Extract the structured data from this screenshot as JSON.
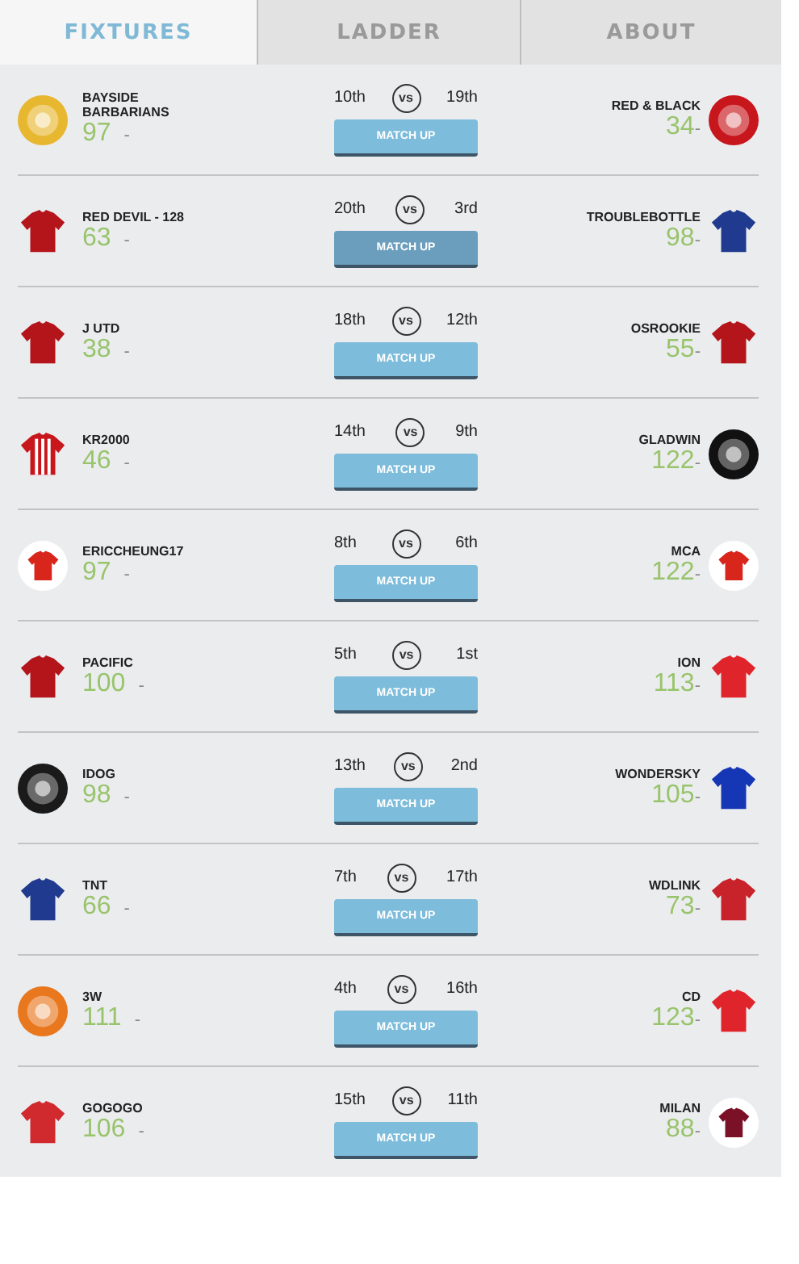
{
  "tabs": [
    {
      "label": "FIXTURES",
      "selected": true
    },
    {
      "label": "LADDER",
      "selected": false
    },
    {
      "label": "ABOUT",
      "selected": false
    }
  ],
  "fixtures": [
    {
      "home": {
        "name": "BAYSIDE BARBARIANS",
        "score": "97",
        "mark": "-",
        "kind": "badge",
        "color": "#e8b730"
      },
      "home_rank": "10th",
      "vs": "vs",
      "away_rank": "19th",
      "button": {
        "label": "MATCH UP",
        "active": false
      },
      "away": {
        "name": "RED & BLACK",
        "score": "34",
        "mark": "-",
        "kind": "badge",
        "color": "#c8161d"
      }
    },
    {
      "home": {
        "name": "RED DEVIL - 128",
        "score": "63",
        "mark": "-",
        "kind": "shirt",
        "color": "#b3151b"
      },
      "home_rank": "20th",
      "vs": "vs",
      "away_rank": "3rd",
      "button": {
        "label": "MATCH UP",
        "active": true
      },
      "away": {
        "name": "TROUBLEBOTTLE",
        "score": "98",
        "mark": "-",
        "kind": "shirt",
        "color": "#1f3a8f"
      }
    },
    {
      "home": {
        "name": "J UTD",
        "score": "38",
        "mark": "-",
        "kind": "shirt",
        "color": "#b3151b"
      },
      "home_rank": "18th",
      "vs": "vs",
      "away_rank": "12th",
      "button": {
        "label": "MATCH UP",
        "active": false
      },
      "away": {
        "name": "OSROOKIE",
        "score": "55",
        "mark": "-",
        "kind": "shirt",
        "color": "#b3151b"
      }
    },
    {
      "home": {
        "name": "KR2000",
        "score": "46",
        "mark": "-",
        "kind": "striped-shirt",
        "color": "#c8161d"
      },
      "home_rank": "14th",
      "vs": "vs",
      "away_rank": "9th",
      "button": {
        "label": "MATCH UP",
        "active": false
      },
      "away": {
        "name": "GLADWIN",
        "score": "122",
        "mark": "-",
        "kind": "badge",
        "color": "#111111"
      }
    },
    {
      "home": {
        "name": "ERICCHEUNG17",
        "score": "97",
        "mark": "-",
        "kind": "shirt-disc",
        "color": "#d9261c"
      },
      "home_rank": "8th",
      "vs": "vs",
      "away_rank": "6th",
      "button": {
        "label": "MATCH UP",
        "active": false
      },
      "away": {
        "name": "MCA",
        "score": "122",
        "mark": "-",
        "kind": "shirt-disc",
        "color": "#d9261c"
      }
    },
    {
      "home": {
        "name": "PACIFIC",
        "score": "100",
        "mark": "-",
        "kind": "shirt",
        "color": "#b3151b"
      },
      "home_rank": "5th",
      "vs": "vs",
      "away_rank": "1st",
      "button": {
        "label": "MATCH UP",
        "active": false
      },
      "away": {
        "name": "ION",
        "score": "113",
        "mark": "-",
        "kind": "shirt",
        "color": "#e0242b"
      }
    },
    {
      "home": {
        "name": "IDOG",
        "score": "98",
        "mark": "-",
        "kind": "badge",
        "color": "#1a1a1a"
      },
      "home_rank": "13th",
      "vs": "vs",
      "away_rank": "2nd",
      "button": {
        "label": "MATCH UP",
        "active": false
      },
      "away": {
        "name": "WONDERSKY",
        "score": "105",
        "mark": "-",
        "kind": "shirt",
        "color": "#1537b5"
      }
    },
    {
      "home": {
        "name": "TNT",
        "score": "66",
        "mark": "-",
        "kind": "shirt",
        "color": "#1f3a8f"
      },
      "home_rank": "7th",
      "vs": "vs",
      "away_rank": "17th",
      "button": {
        "label": "MATCH UP",
        "active": false
      },
      "away": {
        "name": "WDLINK",
        "score": "73",
        "mark": "-",
        "kind": "shirt",
        "color": "#c8232b"
      }
    },
    {
      "home": {
        "name": "3W",
        "score": "111",
        "mark": "-",
        "kind": "badge",
        "color": "#e8771e"
      },
      "home_rank": "4th",
      "vs": "vs",
      "away_rank": "16th",
      "button": {
        "label": "MATCH UP",
        "active": false
      },
      "away": {
        "name": "CD",
        "score": "123",
        "mark": "-",
        "kind": "shirt",
        "color": "#e0242b"
      }
    },
    {
      "home": {
        "name": "GOGOGO",
        "score": "106",
        "mark": "-",
        "kind": "shirt",
        "color": "#d02a2f"
      },
      "home_rank": "15th",
      "vs": "vs",
      "away_rank": "11th",
      "button": {
        "label": "MATCH UP",
        "active": false
      },
      "away": {
        "name": "MILAN",
        "score": "88",
        "mark": "-",
        "kind": "shirt-disc",
        "color": "#7a1126"
      }
    }
  ]
}
